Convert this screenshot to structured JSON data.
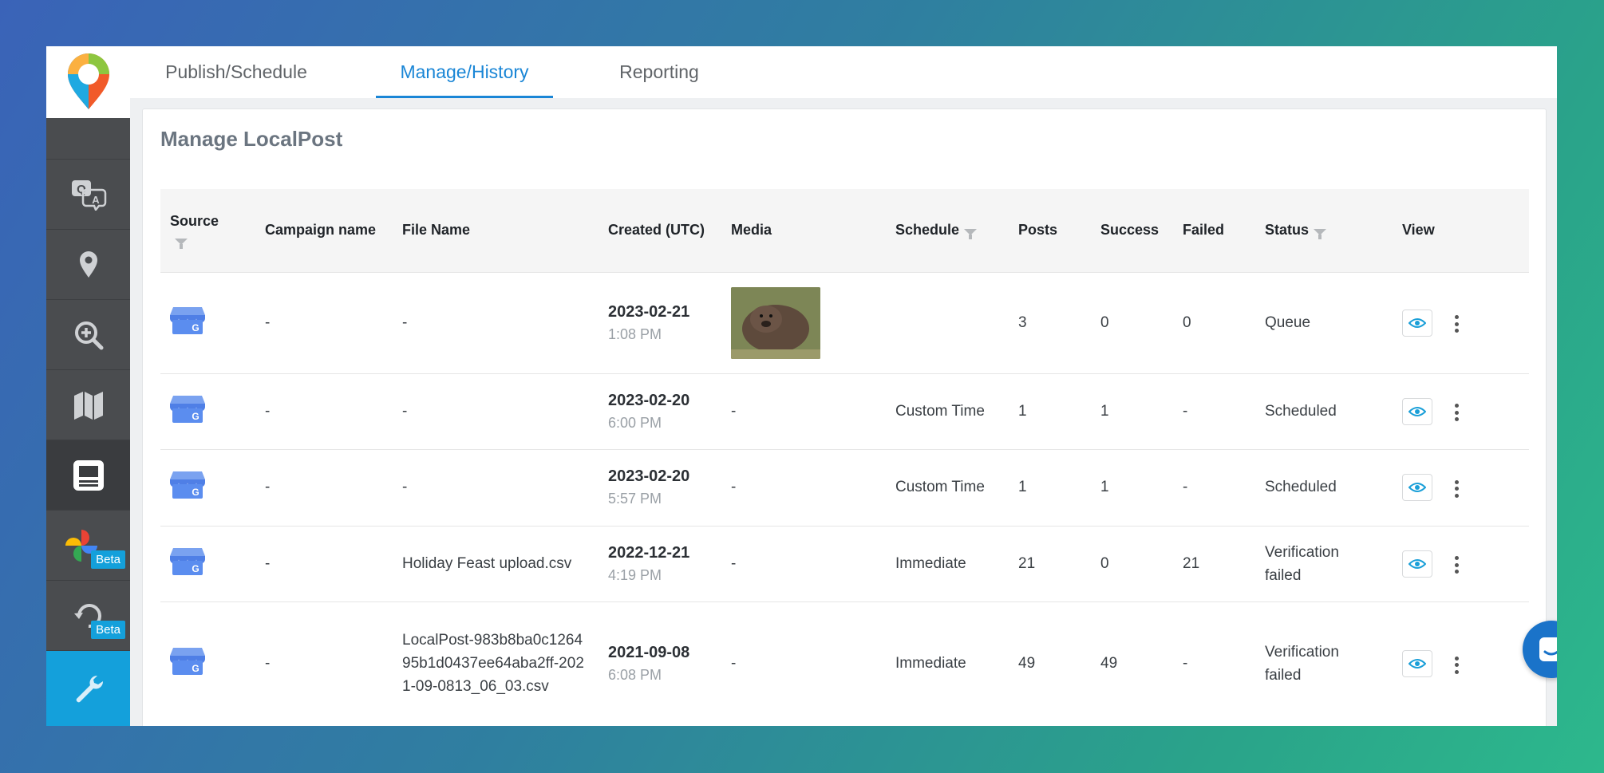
{
  "tabs": [
    {
      "label": "Publish/Schedule",
      "active": false
    },
    {
      "label": "Manage/History",
      "active": true
    },
    {
      "label": "Reporting",
      "active": false
    }
  ],
  "sidebar": {
    "items": [
      {
        "icon": "qa-icon"
      },
      {
        "icon": "location-pin-icon"
      },
      {
        "icon": "zoom-in-icon"
      },
      {
        "icon": "map-icon"
      },
      {
        "icon": "posts-icon",
        "active": true
      },
      {
        "icon": "pinwheel-icon",
        "badge": "Beta"
      },
      {
        "icon": "refresh-search-icon",
        "badge": "Beta"
      },
      {
        "icon": "wrench-icon"
      }
    ]
  },
  "page": {
    "title": "Manage LocalPost"
  },
  "table": {
    "headers": {
      "source": "Source",
      "campaign": "Campaign name",
      "file": "File Name",
      "created": "Created (UTC)",
      "media": "Media",
      "schedule": "Schedule",
      "posts": "Posts",
      "success": "Success",
      "failed": "Failed",
      "status": "Status",
      "view": "View"
    },
    "rows": [
      {
        "campaign": "-",
        "file": "-",
        "date": "2023-02-21",
        "time": "1:08 PM",
        "media": "wombat photo",
        "schedule": "",
        "posts": "3",
        "success": "0",
        "failed": "0",
        "status": "Queue"
      },
      {
        "campaign": "-",
        "file": "-",
        "date": "2023-02-20",
        "time": "6:00 PM",
        "media": "-",
        "schedule": "Custom Time",
        "posts": "1",
        "success": "1",
        "failed": "-",
        "status": "Scheduled"
      },
      {
        "campaign": "-",
        "file": "-",
        "date": "2023-02-20",
        "time": "5:57 PM",
        "media": "-",
        "schedule": "Custom Time",
        "posts": "1",
        "success": "1",
        "failed": "-",
        "status": "Scheduled"
      },
      {
        "campaign": "-",
        "file": "Holiday Feast upload.csv",
        "date": "2022-12-21",
        "time": "4:19 PM",
        "media": "-",
        "schedule": "Immediate",
        "posts": "21",
        "success": "0",
        "failed": "21",
        "status": "Verification failed"
      },
      {
        "campaign": "-",
        "file": "LocalPost-983b8ba0c126495b1d0437ee64aba2ff-2021-09-0813_06_03.csv",
        "date": "2021-09-08",
        "time": "6:08 PM",
        "media": "-",
        "schedule": "Immediate",
        "posts": "49",
        "success": "49",
        "failed": "-",
        "status": "Verification failed"
      }
    ]
  },
  "colors": {
    "accent": "#1a86d6",
    "sidebar": "#4a4c4f",
    "tools": "#14a0db"
  }
}
